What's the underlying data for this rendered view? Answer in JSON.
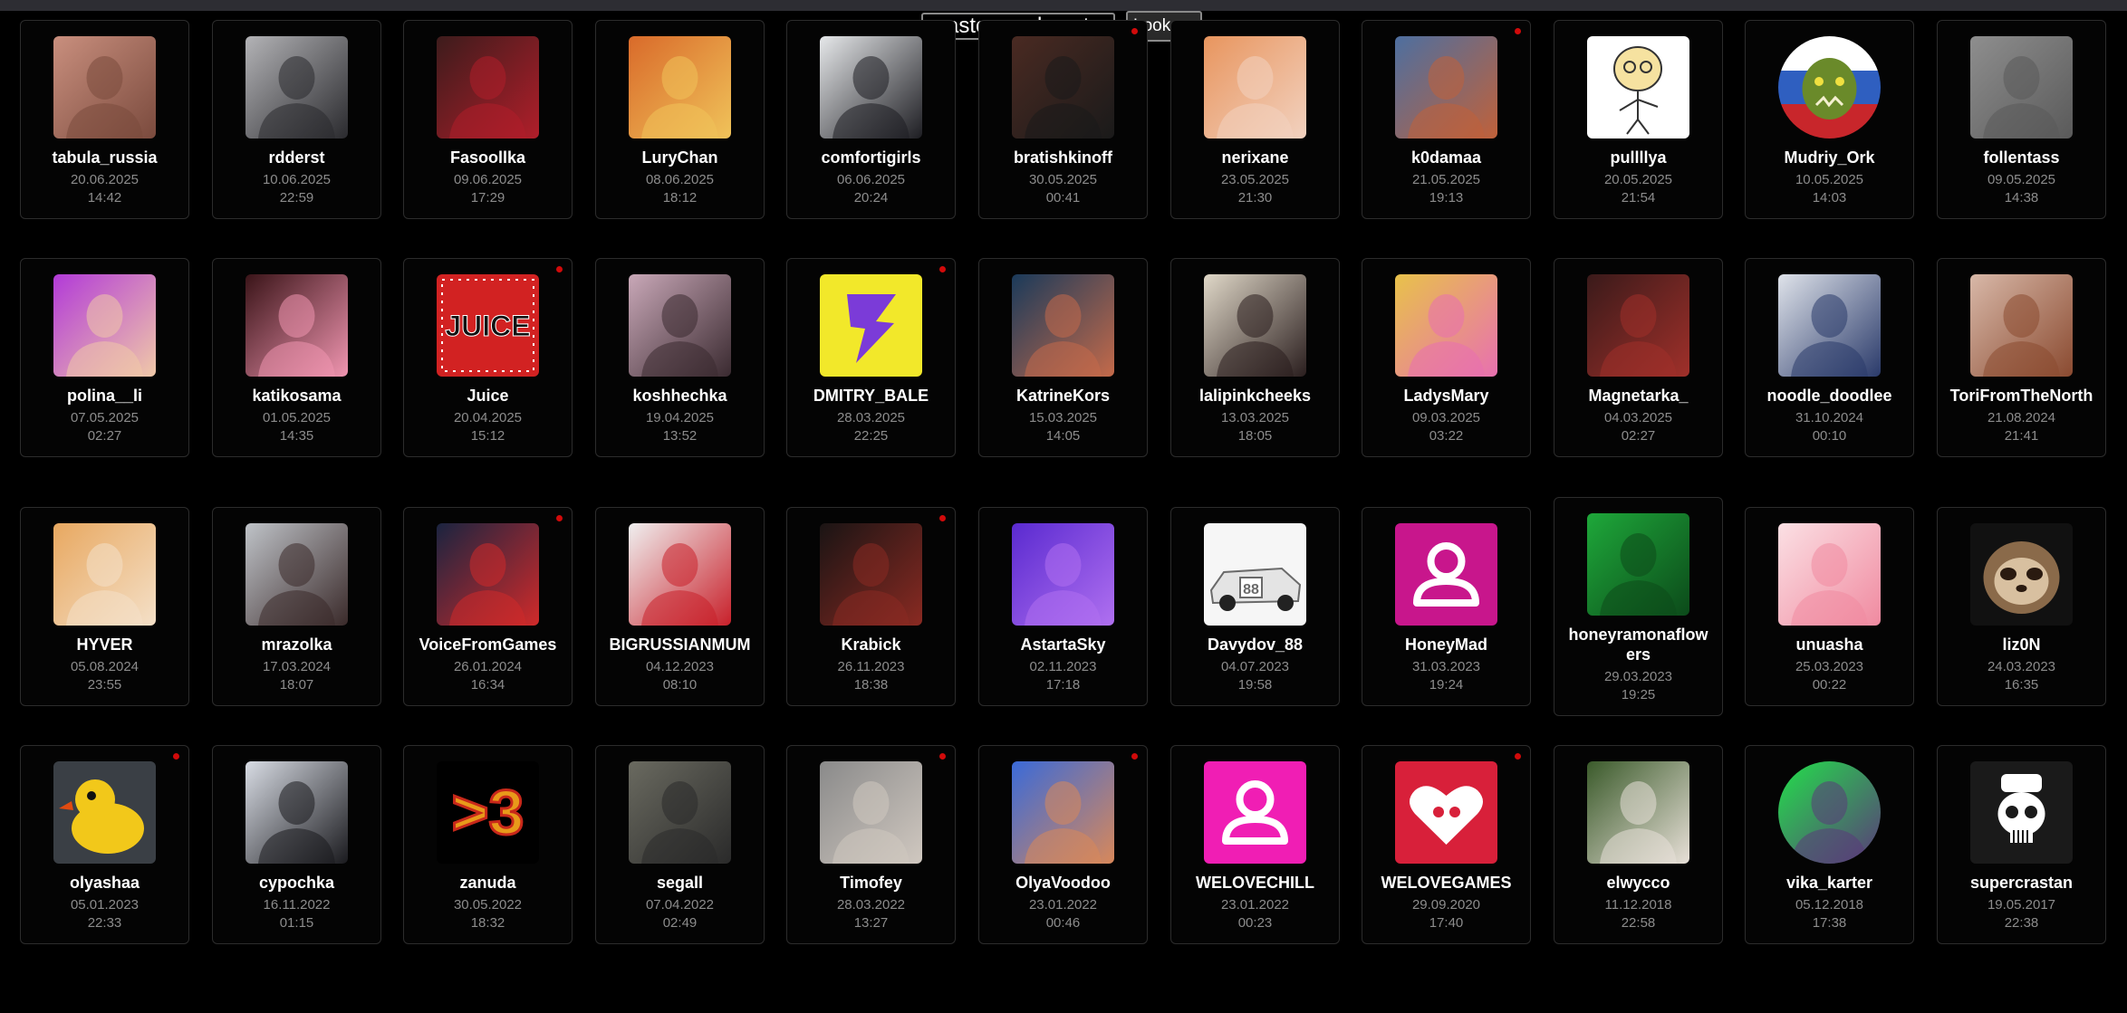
{
  "search": {
    "value": "master_vedmaster",
    "button_label": "Look up"
  },
  "colors": {
    "background": "#000000",
    "card_border": "#2c2c2c",
    "live_dot": "#d10a0a",
    "date_text": "#8c8c8c"
  },
  "rows": [
    {
      "cards": [
        {
          "name": "tabula_russia",
          "date": "20.06.2025",
          "time": "14:42",
          "live": false,
          "avatar": "photo-woman-long-hair",
          "palette": [
            "#c98f7e",
            "#7a4a3d"
          ]
        },
        {
          "name": "rdderst",
          "date": "10.06.2025",
          "time": "22:59",
          "live": false,
          "avatar": "photo-woman-posing",
          "palette": [
            "#b3b3b6",
            "#2a2a2e"
          ]
        },
        {
          "name": "Fasoollka",
          "date": "09.06.2025",
          "time": "17:29",
          "live": false,
          "avatar": "hooded-mask-character",
          "palette": [
            "#3d1c1c",
            "#b01e2a"
          ]
        },
        {
          "name": "LuryChan",
          "date": "08.06.2025",
          "time": "18:12",
          "live": false,
          "avatar": "photo-redhead-cosplay",
          "palette": [
            "#d96a2a",
            "#f0c35a"
          ]
        },
        {
          "name": "comfortigirls",
          "date": "06.06.2025",
          "time": "20:24",
          "live": false,
          "avatar": "photo-three-women",
          "palette": [
            "#e6e8ea",
            "#1d1d22"
          ]
        },
        {
          "name": "bratishkinoff",
          "date": "30.05.2025",
          "time": "00:41",
          "live": true,
          "avatar": "photo-man-glasses",
          "palette": [
            "#4a2a22",
            "#1a1a1a"
          ]
        },
        {
          "name": "nerixane",
          "date": "23.05.2025",
          "time": "21:30",
          "live": false,
          "avatar": "anime-girl-orange",
          "palette": [
            "#e8955e",
            "#f2d2c0"
          ]
        },
        {
          "name": "k0damaa",
          "date": "21.05.2025",
          "time": "19:13",
          "live": true,
          "avatar": "photo-girl-red-hair",
          "palette": [
            "#4d6fa0",
            "#c0613a"
          ]
        },
        {
          "name": "pullllya",
          "date": "20.05.2025",
          "time": "21:54",
          "live": false,
          "avatar": "drawing-stick-figure",
          "palette": [
            "#ffffff",
            "#e8c65a"
          ]
        },
        {
          "name": "Mudriy_Ork",
          "date": "10.05.2025",
          "time": "14:03",
          "live": false,
          "avatar": "orc-flag",
          "palette": [
            "#2f5fc0",
            "#c8262b"
          ]
        },
        {
          "name": "follentass",
          "date": "09.05.2025",
          "time": "14:38",
          "live": false,
          "avatar": "gray-creature",
          "palette": [
            "#8e8e8e",
            "#5a5a5a"
          ]
        }
      ]
    },
    {
      "cards": [
        {
          "name": "polina__li",
          "date": "07.05.2025",
          "time": "02:27",
          "live": false,
          "avatar": "photo-blonde-neon",
          "palette": [
            "#b23ad8",
            "#f0c9a8"
          ]
        },
        {
          "name": "katikosama",
          "date": "01.05.2025",
          "time": "14:35",
          "live": false,
          "avatar": "photo-pink-hair",
          "palette": [
            "#3a1418",
            "#f095b0"
          ]
        },
        {
          "name": "Juice",
          "date": "20.04.2025",
          "time": "15:12",
          "live": true,
          "avatar": "juice-logo",
          "palette": [
            "#d22222",
            "#111111"
          ]
        },
        {
          "name": "koshhechka",
          "date": "19.04.2025",
          "time": "13:52",
          "live": false,
          "avatar": "photo-cherry-blossom",
          "palette": [
            "#c9a8b8",
            "#3a2a30"
          ]
        },
        {
          "name": "DMITRY_BALE",
          "date": "28.03.2025",
          "time": "22:25",
          "live": true,
          "avatar": "purple-b-logo",
          "palette": [
            "#f2e82a",
            "#7b3bd8"
          ]
        },
        {
          "name": "KatrineKors",
          "date": "15.03.2025",
          "time": "14:05",
          "live": false,
          "avatar": "photo-dark-hair-blue",
          "palette": [
            "#1a3a5a",
            "#c46a4a"
          ]
        },
        {
          "name": "lalipinkcheeks",
          "date": "13.03.2025",
          "time": "18:05",
          "live": false,
          "avatar": "photo-dark-hair-girl",
          "palette": [
            "#e0d8c8",
            "#2a1e1e"
          ]
        },
        {
          "name": "LadysMary",
          "date": "09.03.2025",
          "time": "03:22",
          "live": false,
          "avatar": "photo-curly-hair",
          "palette": [
            "#e8c24a",
            "#e870b0"
          ]
        },
        {
          "name": "Magnetarka_",
          "date": "04.03.2025",
          "time": "02:27",
          "live": false,
          "avatar": "photo-glasses-red",
          "palette": [
            "#3a1a1a",
            "#a0302a"
          ]
        },
        {
          "name": "noodle_doodlee",
          "date": "31.10.2024",
          "time": "00:10",
          "live": false,
          "avatar": "anime-figure-white",
          "palette": [
            "#dfe3ea",
            "#2a3a6a"
          ]
        },
        {
          "name": "ToriFromTheNorth",
          "date": "21.08.2024",
          "time": "21:41",
          "live": false,
          "avatar": "photo-auburn-hair",
          "palette": [
            "#d8b8a8",
            "#8a4a30"
          ]
        }
      ]
    },
    {
      "cards": [
        {
          "name": "HYVER",
          "date": "05.08.2024",
          "time": "23:55",
          "live": false,
          "avatar": "fluffy-cat",
          "palette": [
            "#e8a860",
            "#f4e0c8"
          ]
        },
        {
          "name": "mrazolka",
          "date": "17.03.2024",
          "time": "18:07",
          "live": false,
          "avatar": "photo-gray-hair",
          "palette": [
            "#bfc3c8",
            "#3a2a2a"
          ]
        },
        {
          "name": "VoiceFromGames",
          "date": "26.01.2024",
          "time": "16:34",
          "live": true,
          "avatar": "photo-headset-red",
          "palette": [
            "#1a2440",
            "#d02a2a"
          ]
        },
        {
          "name": "BIGRUSSIANMUM",
          "date": "04.12.2023",
          "time": "08:10",
          "live": false,
          "avatar": "photo-red-outfit",
          "palette": [
            "#f0f0f0",
            "#c8202a"
          ]
        },
        {
          "name": "Krabick",
          "date": "26.11.2023",
          "time": "18:38",
          "live": true,
          "avatar": "game-character-dark",
          "palette": [
            "#1a1414",
            "#8a2a22"
          ]
        },
        {
          "name": "AstartaSky",
          "date": "02.11.2023",
          "time": "17:18",
          "live": false,
          "avatar": "purple-hair-art",
          "palette": [
            "#5a2ad0",
            "#b070f0"
          ]
        },
        {
          "name": "Davydov_88",
          "date": "04.07.2023",
          "time": "19:58",
          "live": false,
          "avatar": "race-car",
          "palette": [
            "#e4e4e4",
            "#6a6a6a"
          ]
        },
        {
          "name": "HoneyMad",
          "date": "31.03.2023",
          "time": "19:24",
          "live": false,
          "avatar": "default-user-magenta",
          "palette": [
            "#c8168c",
            "#ffffff"
          ]
        },
        {
          "name": "honeyramonaflowers",
          "date": "29.03.2023",
          "time": "19:25",
          "live": false,
          "avatar": "photo-green-tint",
          "palette": [
            "#1ea83a",
            "#0c4a1a"
          ]
        },
        {
          "name": "unuasha",
          "date": "25.03.2023",
          "time": "00:22",
          "live": false,
          "avatar": "anime-pink-chibi",
          "palette": [
            "#fbe0e4",
            "#f08aa0"
          ]
        },
        {
          "name": "liz0N",
          "date": "24.03.2023",
          "time": "16:35",
          "live": false,
          "avatar": "pixel-sloth",
          "palette": [
            "#111111",
            "#8a6a4a"
          ]
        }
      ]
    },
    {
      "cards": [
        {
          "name": "olyashaa",
          "date": "05.01.2023",
          "time": "22:33",
          "live": true,
          "avatar": "yellow-duck",
          "palette": [
            "#f2c81a",
            "#e04a10"
          ]
        },
        {
          "name": "cypochka",
          "date": "16.11.2022",
          "time": "01:15",
          "live": false,
          "avatar": "photo-dark-hair-top",
          "palette": [
            "#d8dce4",
            "#1a1a1e"
          ]
        },
        {
          "name": "zanuda",
          "date": "30.05.2022",
          "time": "18:32",
          "live": false,
          "avatar": "greater-than-three",
          "palette": [
            "#000000",
            "#e89a1a"
          ]
        },
        {
          "name": "segall",
          "date": "07.04.2022",
          "time": "02:49",
          "live": false,
          "avatar": "photo-man-cap",
          "palette": [
            "#6a6a60",
            "#2a2a2a"
          ]
        },
        {
          "name": "Timofey",
          "date": "28.03.2022",
          "time": "13:27",
          "live": true,
          "avatar": "cat-eyepatch",
          "palette": [
            "#8a8a8a",
            "#d0c8c0"
          ]
        },
        {
          "name": "OlyaVoodoo",
          "date": "23.01.2022",
          "time": "00:46",
          "live": true,
          "avatar": "art-girl-neon",
          "palette": [
            "#3a6ad8",
            "#d8885a"
          ]
        },
        {
          "name": "WELOVECHILL",
          "date": "23.01.2022",
          "time": "00:23",
          "live": false,
          "avatar": "default-user-pink",
          "palette": [
            "#f01eb4",
            "#ffffff"
          ]
        },
        {
          "name": "WELOVEGAMES",
          "date": "29.09.2020",
          "time": "17:40",
          "live": true,
          "avatar": "heart-gamepad",
          "palette": [
            "#d8203a",
            "#ffffff"
          ]
        },
        {
          "name": "elwycco",
          "date": "11.12.2018",
          "time": "22:58",
          "live": false,
          "avatar": "joker-face",
          "palette": [
            "#3a5a2a",
            "#e8e0d8"
          ]
        },
        {
          "name": "vika_karter",
          "date": "05.12.2018",
          "time": "17:38",
          "live": false,
          "avatar": "green-ring-portrait",
          "palette": [
            "#22e04a",
            "#5a3a7a"
          ]
        },
        {
          "name": "supercrastan",
          "date": "19.05.2017",
          "time": "22:38",
          "live": false,
          "avatar": "skull-chef",
          "palette": [
            "#1a1a1a",
            "#ffffff"
          ]
        }
      ]
    }
  ]
}
